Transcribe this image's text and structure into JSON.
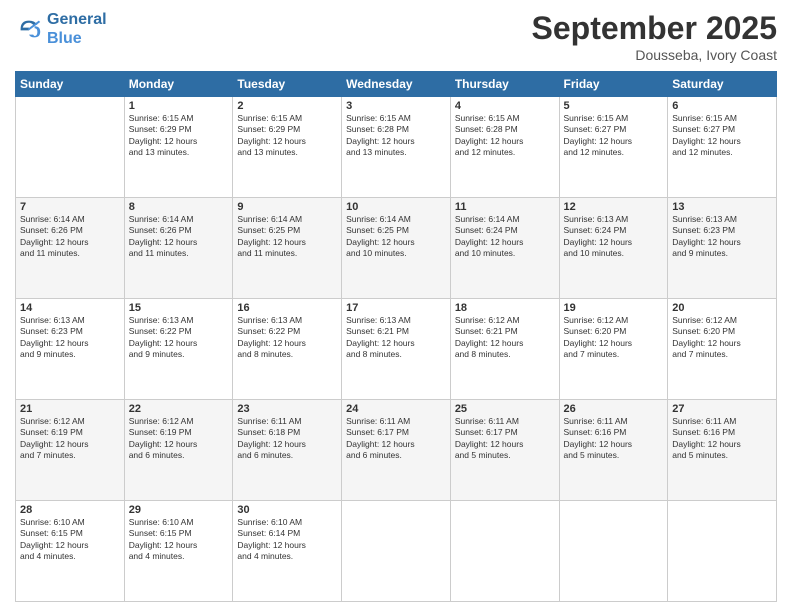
{
  "header": {
    "logo_line1": "General",
    "logo_line2": "Blue",
    "month_title": "September 2025",
    "location": "Dousseba, Ivory Coast"
  },
  "days_of_week": [
    "Sunday",
    "Monday",
    "Tuesday",
    "Wednesday",
    "Thursday",
    "Friday",
    "Saturday"
  ],
  "weeks": [
    [
      {
        "day": "",
        "info": ""
      },
      {
        "day": "1",
        "info": "Sunrise: 6:15 AM\nSunset: 6:29 PM\nDaylight: 12 hours\nand 13 minutes."
      },
      {
        "day": "2",
        "info": "Sunrise: 6:15 AM\nSunset: 6:29 PM\nDaylight: 12 hours\nand 13 minutes."
      },
      {
        "day": "3",
        "info": "Sunrise: 6:15 AM\nSunset: 6:28 PM\nDaylight: 12 hours\nand 13 minutes."
      },
      {
        "day": "4",
        "info": "Sunrise: 6:15 AM\nSunset: 6:28 PM\nDaylight: 12 hours\nand 12 minutes."
      },
      {
        "day": "5",
        "info": "Sunrise: 6:15 AM\nSunset: 6:27 PM\nDaylight: 12 hours\nand 12 minutes."
      },
      {
        "day": "6",
        "info": "Sunrise: 6:15 AM\nSunset: 6:27 PM\nDaylight: 12 hours\nand 12 minutes."
      }
    ],
    [
      {
        "day": "7",
        "info": "Sunrise: 6:14 AM\nSunset: 6:26 PM\nDaylight: 12 hours\nand 11 minutes."
      },
      {
        "day": "8",
        "info": "Sunrise: 6:14 AM\nSunset: 6:26 PM\nDaylight: 12 hours\nand 11 minutes."
      },
      {
        "day": "9",
        "info": "Sunrise: 6:14 AM\nSunset: 6:25 PM\nDaylight: 12 hours\nand 11 minutes."
      },
      {
        "day": "10",
        "info": "Sunrise: 6:14 AM\nSunset: 6:25 PM\nDaylight: 12 hours\nand 10 minutes."
      },
      {
        "day": "11",
        "info": "Sunrise: 6:14 AM\nSunset: 6:24 PM\nDaylight: 12 hours\nand 10 minutes."
      },
      {
        "day": "12",
        "info": "Sunrise: 6:13 AM\nSunset: 6:24 PM\nDaylight: 12 hours\nand 10 minutes."
      },
      {
        "day": "13",
        "info": "Sunrise: 6:13 AM\nSunset: 6:23 PM\nDaylight: 12 hours\nand 9 minutes."
      }
    ],
    [
      {
        "day": "14",
        "info": "Sunrise: 6:13 AM\nSunset: 6:23 PM\nDaylight: 12 hours\nand 9 minutes."
      },
      {
        "day": "15",
        "info": "Sunrise: 6:13 AM\nSunset: 6:22 PM\nDaylight: 12 hours\nand 9 minutes."
      },
      {
        "day": "16",
        "info": "Sunrise: 6:13 AM\nSunset: 6:22 PM\nDaylight: 12 hours\nand 8 minutes."
      },
      {
        "day": "17",
        "info": "Sunrise: 6:13 AM\nSunset: 6:21 PM\nDaylight: 12 hours\nand 8 minutes."
      },
      {
        "day": "18",
        "info": "Sunrise: 6:12 AM\nSunset: 6:21 PM\nDaylight: 12 hours\nand 8 minutes."
      },
      {
        "day": "19",
        "info": "Sunrise: 6:12 AM\nSunset: 6:20 PM\nDaylight: 12 hours\nand 7 minutes."
      },
      {
        "day": "20",
        "info": "Sunrise: 6:12 AM\nSunset: 6:20 PM\nDaylight: 12 hours\nand 7 minutes."
      }
    ],
    [
      {
        "day": "21",
        "info": "Sunrise: 6:12 AM\nSunset: 6:19 PM\nDaylight: 12 hours\nand 7 minutes."
      },
      {
        "day": "22",
        "info": "Sunrise: 6:12 AM\nSunset: 6:19 PM\nDaylight: 12 hours\nand 6 minutes."
      },
      {
        "day": "23",
        "info": "Sunrise: 6:11 AM\nSunset: 6:18 PM\nDaylight: 12 hours\nand 6 minutes."
      },
      {
        "day": "24",
        "info": "Sunrise: 6:11 AM\nSunset: 6:17 PM\nDaylight: 12 hours\nand 6 minutes."
      },
      {
        "day": "25",
        "info": "Sunrise: 6:11 AM\nSunset: 6:17 PM\nDaylight: 12 hours\nand 5 minutes."
      },
      {
        "day": "26",
        "info": "Sunrise: 6:11 AM\nSunset: 6:16 PM\nDaylight: 12 hours\nand 5 minutes."
      },
      {
        "day": "27",
        "info": "Sunrise: 6:11 AM\nSunset: 6:16 PM\nDaylight: 12 hours\nand 5 minutes."
      }
    ],
    [
      {
        "day": "28",
        "info": "Sunrise: 6:10 AM\nSunset: 6:15 PM\nDaylight: 12 hours\nand 4 minutes."
      },
      {
        "day": "29",
        "info": "Sunrise: 6:10 AM\nSunset: 6:15 PM\nDaylight: 12 hours\nand 4 minutes."
      },
      {
        "day": "30",
        "info": "Sunrise: 6:10 AM\nSunset: 6:14 PM\nDaylight: 12 hours\nand 4 minutes."
      },
      {
        "day": "",
        "info": ""
      },
      {
        "day": "",
        "info": ""
      },
      {
        "day": "",
        "info": ""
      },
      {
        "day": "",
        "info": ""
      }
    ]
  ]
}
